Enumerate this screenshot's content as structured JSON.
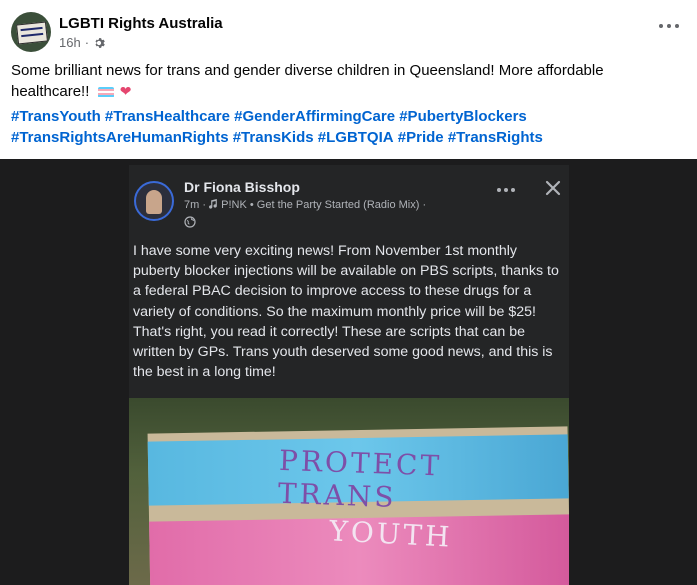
{
  "post": {
    "page_name": "LGBTI Rights Australia",
    "time": "16h",
    "separator": "·",
    "privacy_icon": "gear-icon",
    "body": "Some brilliant news for trans and gender diverse children in Queensland! More affordable healthcare!!",
    "emojis": [
      "transgender-flag",
      "heart"
    ],
    "hashtags": [
      "#TransYouth",
      "#TransHealthcare",
      "#GenderAffirmingCare",
      "#PubertyBlockers",
      "#TransRightsAreHumanRights",
      "#TransKids",
      "#LGBTQIA",
      "#Pride",
      "#TransRights"
    ]
  },
  "shared": {
    "author": "Dr Fiona Bisshop",
    "time": "7m",
    "separator": "·",
    "music_icon": "music-note-icon",
    "song": "P!NK • Get the Party Started (Radio Mix)",
    "trailing_separator": "·",
    "privacy_icon": "globe-icon",
    "text": "I have some very exciting news! From November 1st monthly puberty blocker injections will be available on PBS scripts, thanks to a federal PBAC decision to improve access to these drugs for a variety of conditions. So the maximum monthly price will be $25! That's right, you read it correctly! These are scripts that can be written by GPs. Trans youth deserved some good news, and this is the best in a long time!"
  },
  "photo_sign": {
    "line1": "PROTECT TRANS",
    "line2": "YOUTH"
  },
  "colors": {
    "hashtag": "#0064d1",
    "muted": "#65676b",
    "dark_bg": "#242526"
  }
}
